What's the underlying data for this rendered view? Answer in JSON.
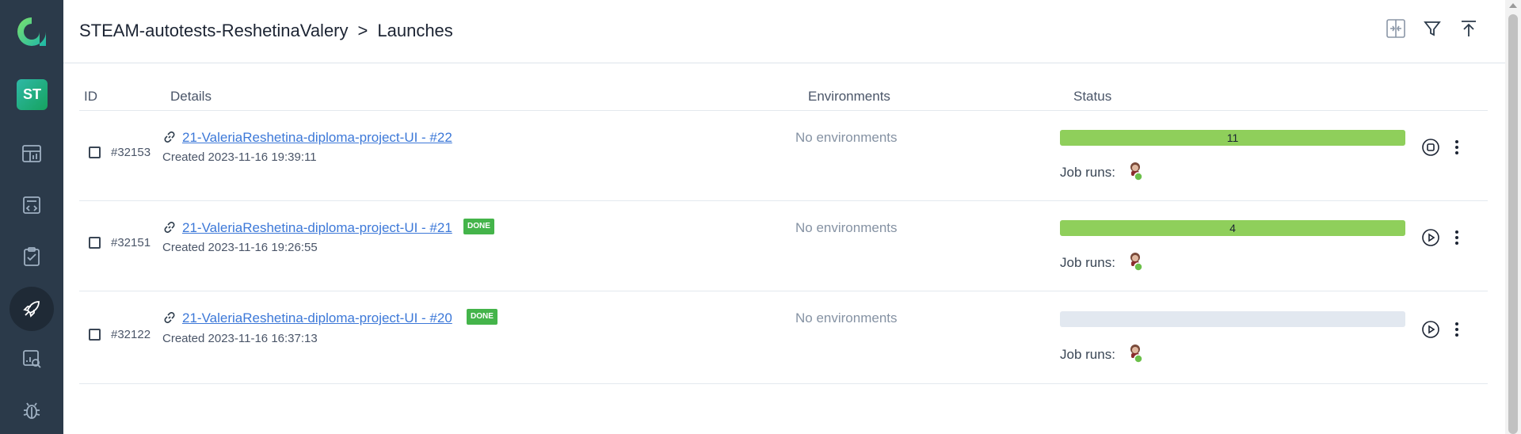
{
  "sidebar": {
    "logo_icon": "allure-logo-icon",
    "project_initials": "ST",
    "nav_icons": [
      "dashboard-icon",
      "testcases-icon",
      "testplans-icon",
      "launches-icon",
      "analytics-icon",
      "defects-icon"
    ]
  },
  "header": {
    "project": "STEAM-autotests-ReshetinaValery",
    "separator": ">",
    "page": "Launches",
    "actions": [
      "compare-icon",
      "filter-icon",
      "upload-icon"
    ]
  },
  "table": {
    "columns": {
      "id": "ID",
      "details": "Details",
      "environments": "Environments",
      "status": "Status"
    },
    "rows": [
      {
        "id": "#32153",
        "name": "21-ValeriaReshetina-diploma-project-UI - #22",
        "badge": "",
        "created": "Created 2023-11-16 19:39:11",
        "environments": "No environments",
        "progress_count": "11",
        "progress_fraction": 1.0,
        "job_runs": "Job runs:",
        "action_icon": "stop-icon"
      },
      {
        "id": "#32151",
        "name": "21-ValeriaReshetina-diploma-project-UI - #21",
        "badge": "DONE",
        "created": "Created 2023-11-16 19:26:55",
        "environments": "No environments",
        "progress_count": "4",
        "progress_fraction": 1.0,
        "job_runs": "Job runs:",
        "action_icon": "play-icon"
      },
      {
        "id": "#32122",
        "name": "21-ValeriaReshetina-diploma-project-UI - #20",
        "badge": "DONE",
        "created": "Created 2023-11-16 16:37:13",
        "environments": "No environments",
        "progress_count": "",
        "progress_fraction": 0,
        "job_runs": "Job runs:",
        "action_icon": "play-icon"
      }
    ]
  },
  "colors": {
    "sidebar_bg": "#2b3a4a",
    "accent_green": "#8fcf5b",
    "badge_green": "#44b44a",
    "link": "#3c78d8"
  }
}
